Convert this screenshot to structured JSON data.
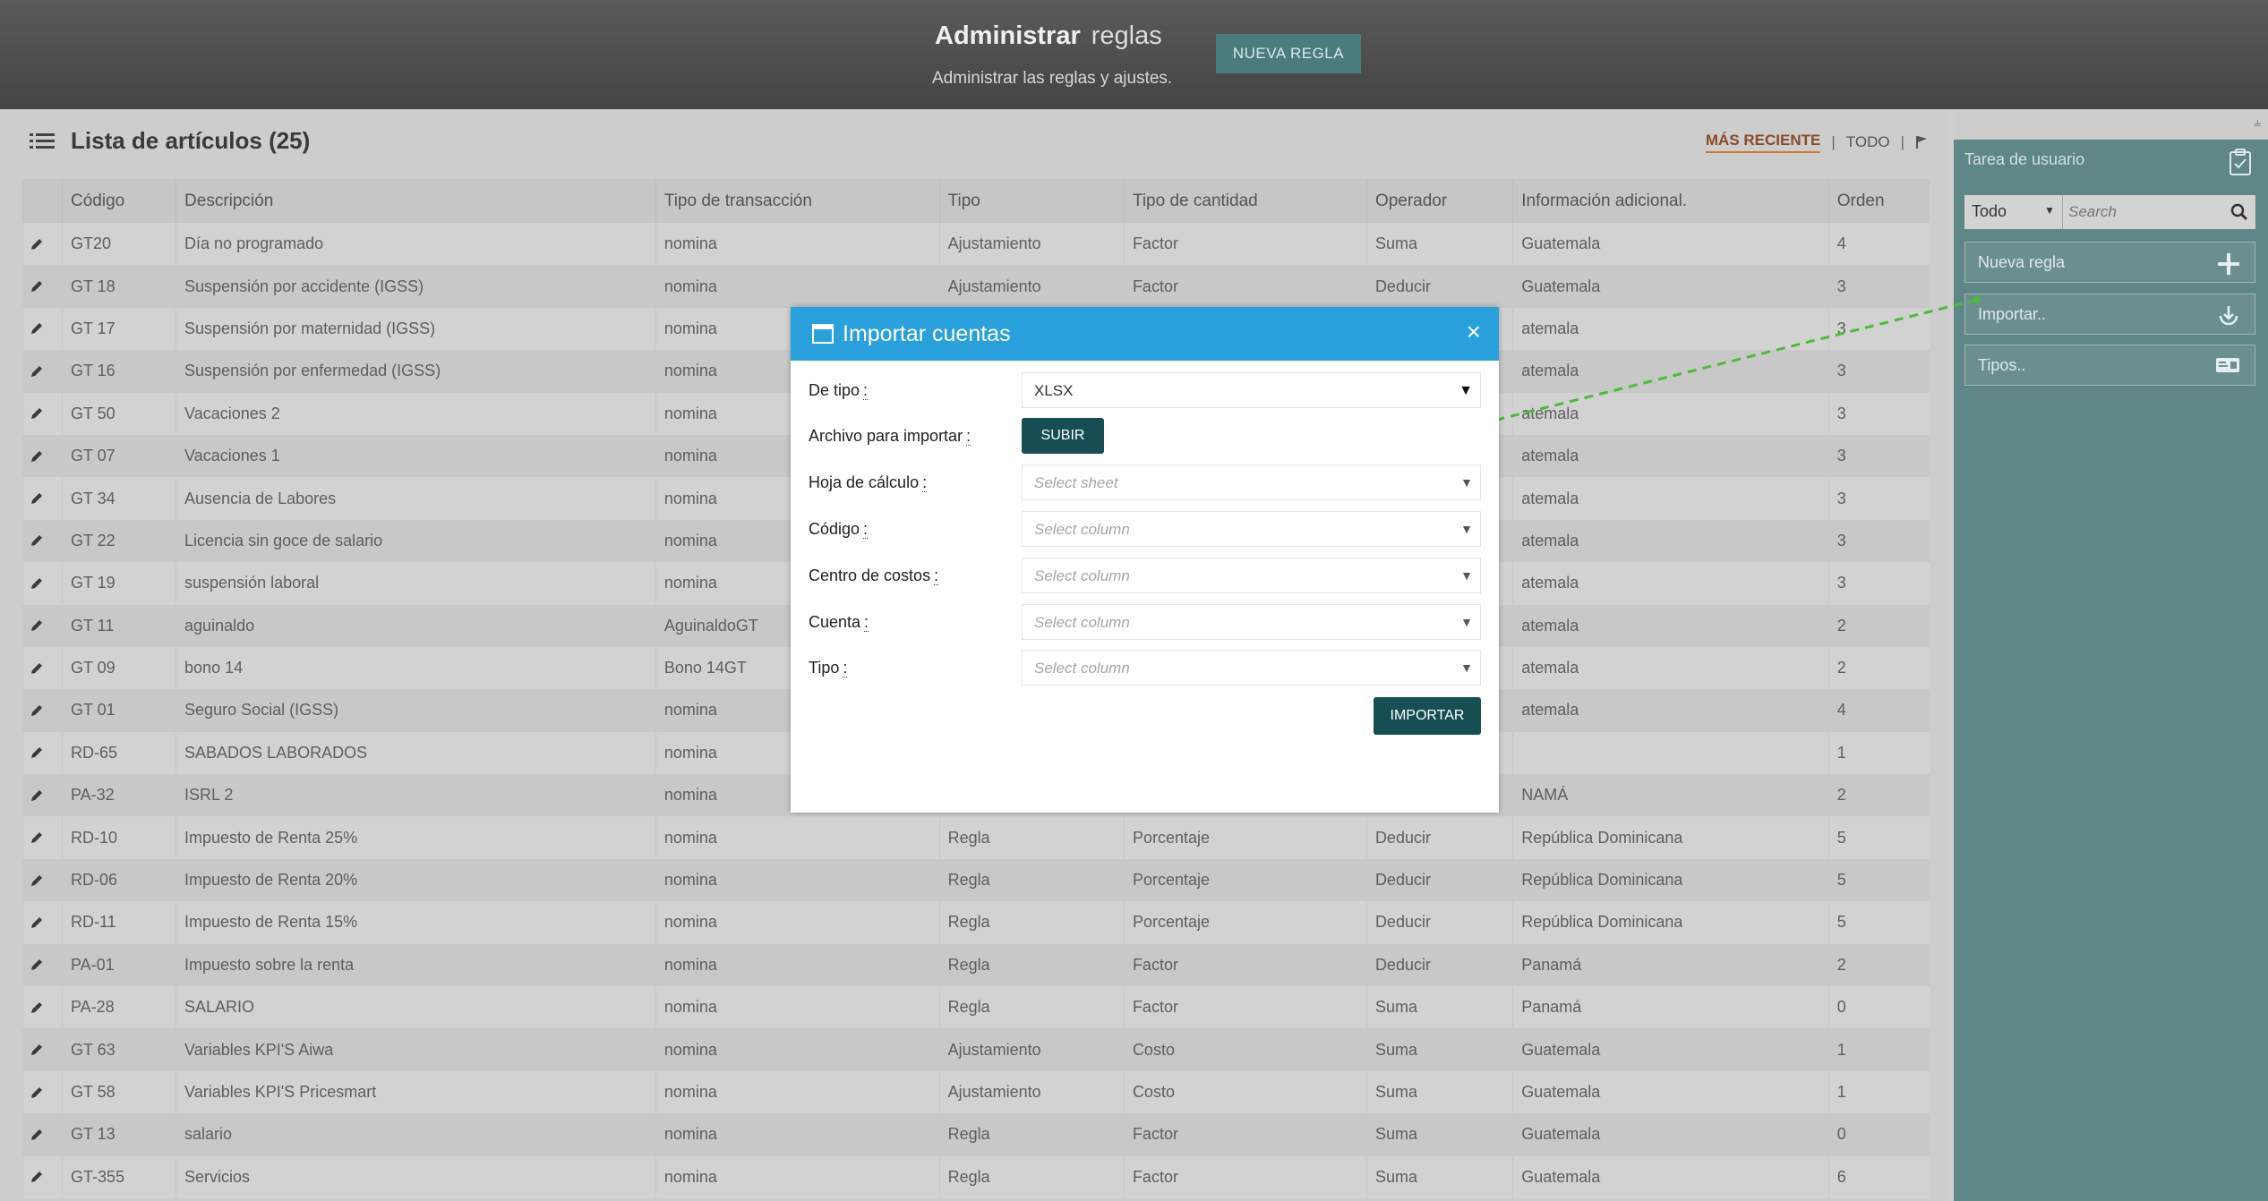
{
  "header": {
    "title_bold": "Administrar",
    "title_light": "reglas",
    "subtitle": "Administrar las reglas y ajustes.",
    "new_rule_label": "NUEVA REGLA"
  },
  "list": {
    "title": "Lista de artículos (25)",
    "filters": {
      "recent": "MÁS RECIENTE",
      "sep1": "|",
      "all": "TODO",
      "sep2": "|"
    },
    "columns": [
      "",
      "Código",
      "Descripción",
      "Tipo de transacción",
      "Tipo",
      "Tipo de cantidad",
      "Operador",
      "Información adicional.",
      "Orden"
    ],
    "rows": [
      [
        "GT20",
        "Día no programado",
        "nomina",
        "Ajustamiento",
        "Factor",
        "Suma",
        "Guatemala",
        "4"
      ],
      [
        "GT 18",
        "Suspensión por accidente (IGSS)",
        "nomina",
        "Ajustamiento",
        "Factor",
        "Deducir",
        "Guatemala",
        "3"
      ],
      [
        "GT 17",
        "Suspensión por maternidad (IGSS)",
        "nomina",
        "",
        "",
        "",
        "atemala",
        "3"
      ],
      [
        "GT 16",
        "Suspensión por enfermedad (IGSS)",
        "nomina",
        "",
        "",
        "",
        "atemala",
        "3"
      ],
      [
        "GT 50",
        "Vacaciones 2",
        "nomina",
        "",
        "",
        "",
        "atemala",
        "3"
      ],
      [
        "GT 07",
        "Vacaciones 1",
        "nomina",
        "",
        "",
        "",
        "atemala",
        "3"
      ],
      [
        "GT 34",
        "Ausencia de Labores",
        "nomina",
        "",
        "",
        "",
        "atemala",
        "3"
      ],
      [
        "GT 22",
        "Licencia sin goce de salario",
        "nomina",
        "",
        "",
        "",
        "atemala",
        "3"
      ],
      [
        "GT 19",
        "suspensión laboral",
        "nomina",
        "",
        "",
        "",
        "atemala",
        "3"
      ],
      [
        "GT 11",
        "aguinaldo",
        "AguinaldoGT",
        "",
        "",
        "",
        "atemala",
        "2"
      ],
      [
        "GT 09",
        "bono 14",
        "Bono 14GT",
        "",
        "",
        "",
        "atemala",
        "2"
      ],
      [
        "GT 01",
        "Seguro Social (IGSS)",
        "nomina",
        "",
        "",
        "",
        "atemala",
        "4"
      ],
      [
        "RD-65",
        "SABADOS LABORADOS",
        "nomina",
        "",
        "",
        "",
        "",
        "1"
      ],
      [
        "PA-32",
        "ISRL 2",
        "nomina",
        "",
        "",
        "",
        "NAMÁ",
        "2"
      ],
      [
        "RD-10",
        "Impuesto de Renta 25%",
        "nomina",
        "Regla",
        "Porcentaje",
        "Deducir",
        "República Dominicana",
        "5"
      ],
      [
        "RD-06",
        "Impuesto de Renta 20%",
        "nomina",
        "Regla",
        "Porcentaje",
        "Deducir",
        "República Dominicana",
        "5"
      ],
      [
        "RD-11",
        "Impuesto de Renta 15%",
        "nomina",
        "Regla",
        "Porcentaje",
        "Deducir",
        "República Dominicana",
        "5"
      ],
      [
        "PA-01",
        "Impuesto sobre la renta",
        "nomina",
        "Regla",
        "Factor",
        "Deducir",
        "Panamá",
        "2"
      ],
      [
        "PA-28",
        "SALARIO",
        "nomina",
        "Regla",
        "Factor",
        "Suma",
        "Panamá",
        "0"
      ],
      [
        "GT 63",
        "Variables KPI'S Aiwa",
        "nomina",
        "Ajustamiento",
        "Costo",
        "Suma",
        "Guatemala",
        "1"
      ],
      [
        "GT 58",
        "Variables KPI'S Pricesmart",
        "nomina",
        "Ajustamiento",
        "Costo",
        "Suma",
        "Guatemala",
        "1"
      ],
      [
        "GT 13",
        "salario",
        "nomina",
        "Regla",
        "Factor",
        "Suma",
        "Guatemala",
        "0"
      ],
      [
        "GT-355",
        "Servicios",
        "nomina",
        "Regla",
        "Factor",
        "Suma",
        "Guatemala",
        "6"
      ]
    ]
  },
  "side": {
    "task_title": "Tarea de usuario",
    "filter_value": "Todo",
    "search_placeholder": "Search",
    "new_rule": "Nueva regla",
    "import": "Importar..",
    "types": "Tipos.."
  },
  "modal": {
    "title": "Importar cuentas",
    "close": "×",
    "fields": {
      "type_label": "De tipo",
      "type_value": "XLSX",
      "file_label": "Archivo para importar",
      "upload_button": "SUBIR",
      "sheet_label": "Hoja de cálculo",
      "sheet_placeholder": "Select sheet",
      "code_label": "Código",
      "cost_center_label": "Centro de costos",
      "account_label": "Cuenta",
      "kind_label": "Tipo",
      "column_placeholder": "Select column",
      "colon": ":"
    },
    "import_button": "IMPORTAR"
  },
  "colors": {
    "modal_header": "#2aa0dc",
    "primary_button": "#174e54",
    "side_panel": "#5f8787",
    "active_filter_underline": "#d4772c",
    "annotation_arrow": "#4cbb3a"
  }
}
